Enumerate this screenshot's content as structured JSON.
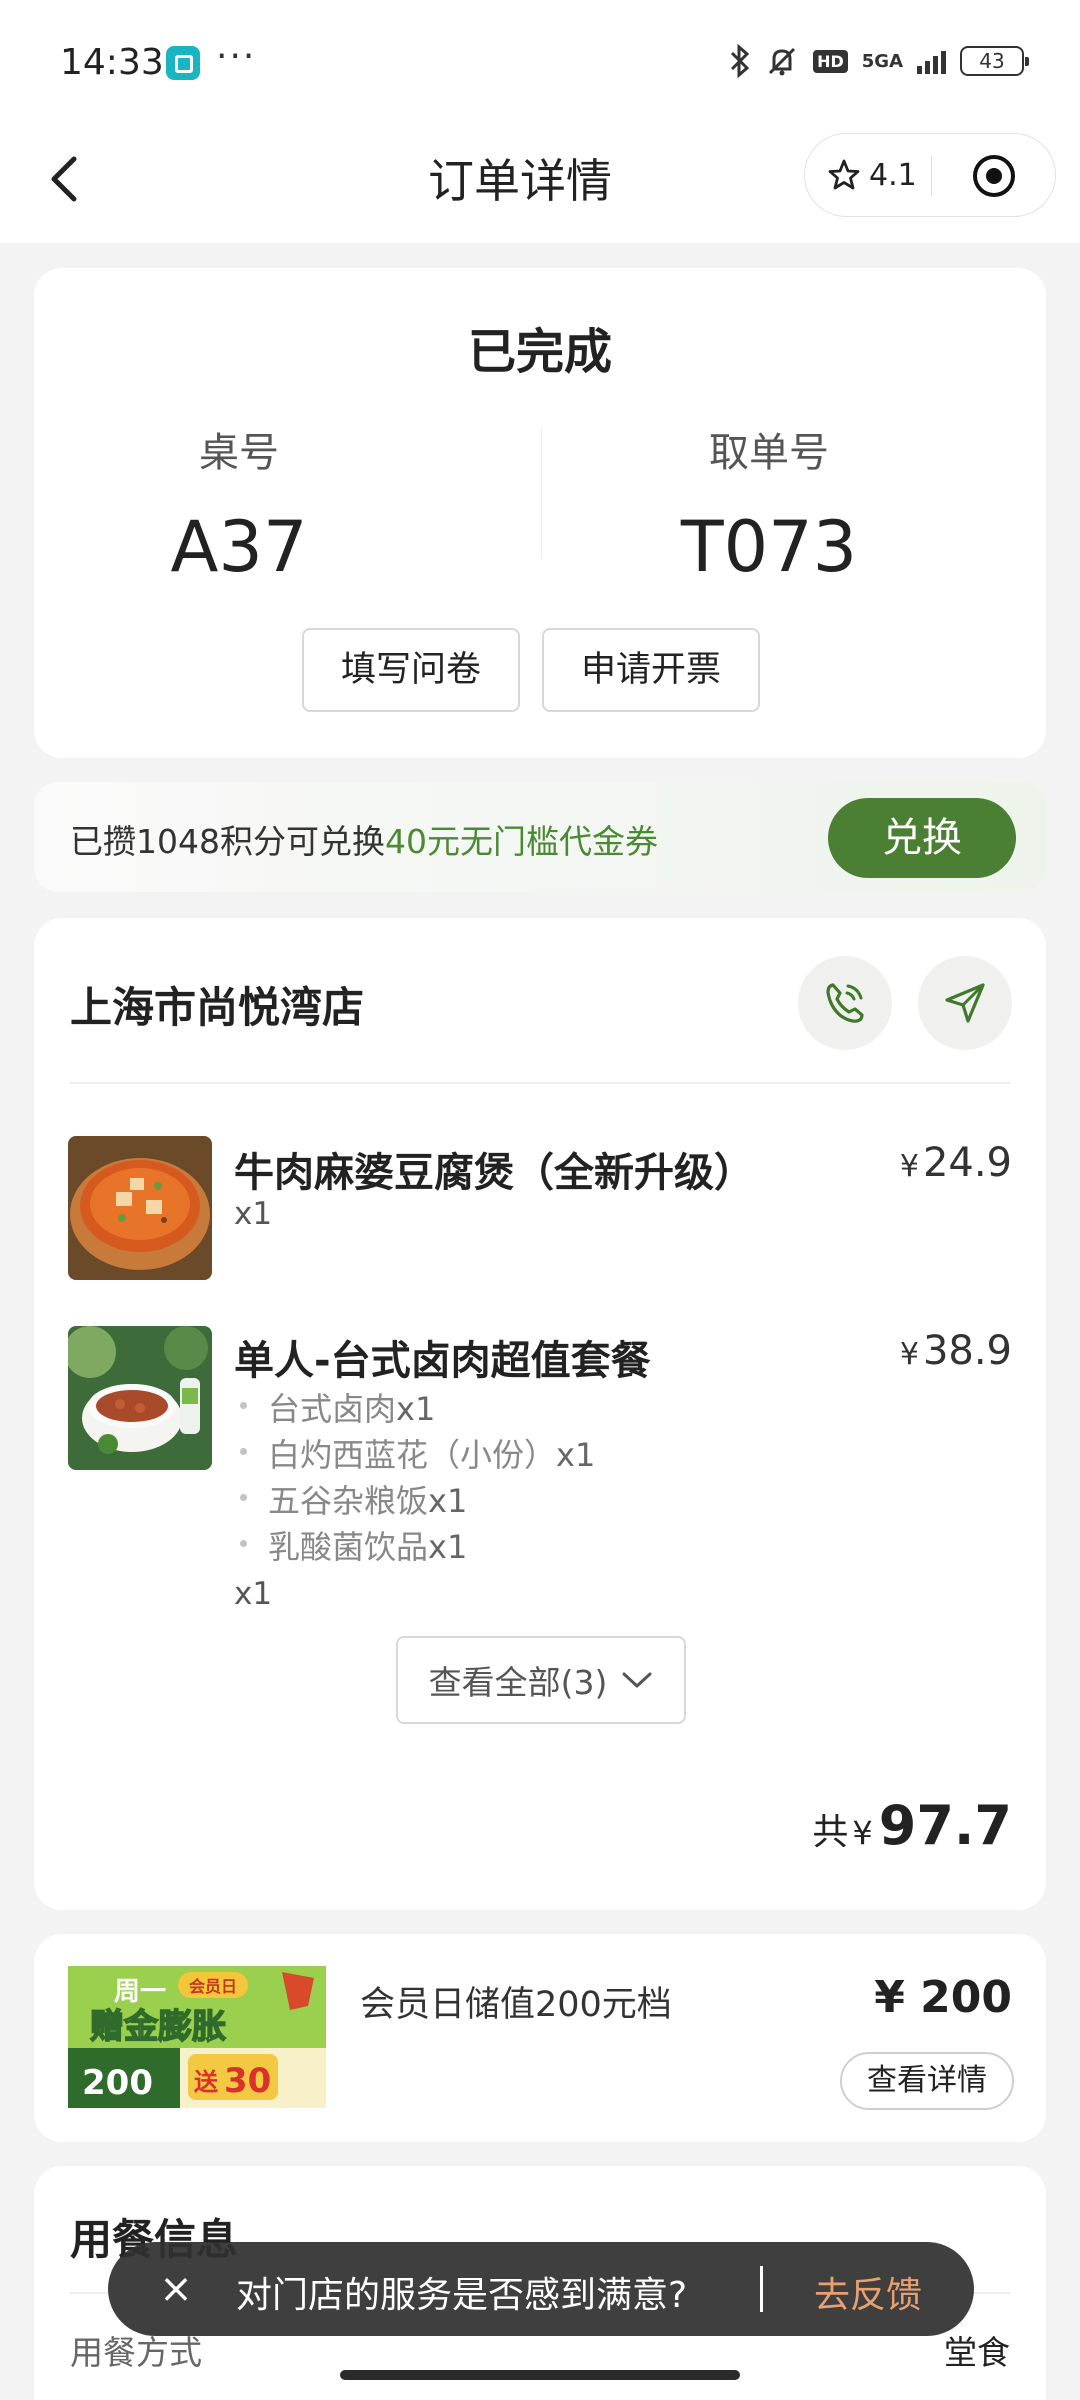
{
  "status_bar": {
    "time": "14:33",
    "more": "···",
    "network_hd": "HD",
    "network_type": "5GA",
    "battery": "43"
  },
  "header": {
    "title": "订单详情",
    "rating": "4.1"
  },
  "order": {
    "status": "已完成",
    "table_label": "桌号",
    "table_value": "A37",
    "pickup_label": "取单号",
    "pickup_value": "T073",
    "survey_button": "填写问卷",
    "invoice_button": "申请开票"
  },
  "points": {
    "text": "已攒1048积分可兑换",
    "highlight": "40元无门槛代金券",
    "button": "兑换"
  },
  "store": {
    "name": "上海市尚悦湾店",
    "items": [
      {
        "name": "牛肉麻婆豆腐煲（全新升级）",
        "currency": "¥",
        "price": "24.9",
        "qty": "x1"
      },
      {
        "name": "单人-台式卤肉超值套餐",
        "currency": "¥",
        "price": "38.9",
        "qty": "x1",
        "sub_items": [
          {
            "name": "台式卤肉",
            "qty": "x1"
          },
          {
            "name": "白灼西蓝花（小份）",
            "qty": "x1"
          },
          {
            "name": "五谷杂粮饭",
            "qty": "x1"
          },
          {
            "name": "乳酸菌饮品",
            "qty": "x1"
          }
        ]
      }
    ],
    "view_all": "查看全部(3)",
    "total_label": "共",
    "total_currency": "¥",
    "total": "97.7"
  },
  "promo": {
    "image_text": {
      "line1": "周一",
      "badge": "会员日",
      "line2": "赠金膨胀",
      "left": "200",
      "right_prefix": "送",
      "right": "30"
    },
    "name": "会员日储值200元档",
    "price": "¥ 200",
    "button": "查看详情"
  },
  "dining": {
    "title": "用餐信息",
    "method_label": "用餐方式",
    "method_value": "堂食"
  },
  "toast": {
    "text": "对门店的服务是否感到满意?",
    "link": "去反馈",
    "close": "×"
  },
  "colors": {
    "accent_green": "#4b7f33",
    "highlight_green": "#4a8a34",
    "toast_link": "#e8a070"
  }
}
